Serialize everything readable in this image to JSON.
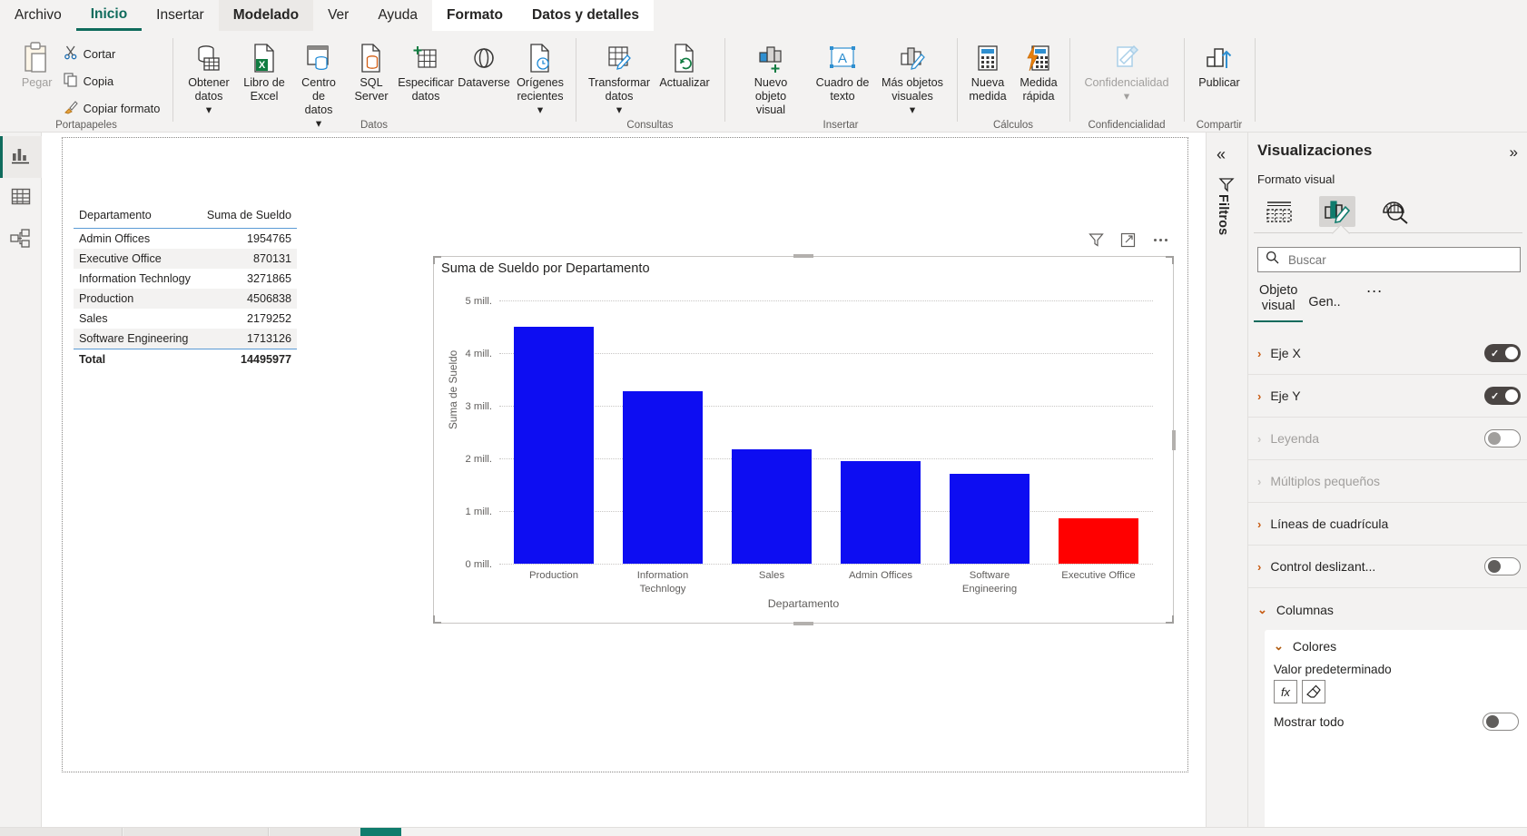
{
  "ribbon": {
    "tabs": [
      {
        "label": "Archivo",
        "style": "plain"
      },
      {
        "label": "Inicio",
        "style": "active"
      },
      {
        "label": "Insertar",
        "style": "plain"
      },
      {
        "label": "Modelado",
        "style": "shaded"
      },
      {
        "label": "Ver",
        "style": "plain"
      },
      {
        "label": "Ayuda",
        "style": "plain"
      },
      {
        "label": "Formato",
        "style": "white"
      },
      {
        "label": "Datos y detalles",
        "style": "white"
      }
    ],
    "groups": [
      {
        "name": "Portapapeles",
        "label": "Portapapeles",
        "paste_label": "Pegar",
        "items": [
          {
            "label": "Cortar",
            "icon": "scissors-icon"
          },
          {
            "label": "Copia",
            "icon": "copy-icon"
          },
          {
            "label": "Copiar formato",
            "icon": "format-painter-icon"
          }
        ]
      },
      {
        "name": "Datos",
        "label": "Datos",
        "items": [
          {
            "label": "Obtener\ndatos",
            "icon": "get-data-icon",
            "dropdown": true
          },
          {
            "label": "Libro de\nExcel",
            "icon": "excel-icon",
            "dropdown": false
          },
          {
            "label": "Centro de\ndatos",
            "icon": "data-hub-icon",
            "dropdown": true
          },
          {
            "label": "SQL\nServer",
            "icon": "sql-server-icon",
            "dropdown": false
          },
          {
            "label": "Especificar\ndatos",
            "icon": "enter-data-icon",
            "dropdown": false
          },
          {
            "label": "Dataverse",
            "icon": "dataverse-icon",
            "dropdown": false
          },
          {
            "label": "Orígenes\nrecientes",
            "icon": "recent-sources-icon",
            "dropdown": true
          }
        ]
      },
      {
        "name": "Consultas",
        "label": "Consultas",
        "items": [
          {
            "label": "Transformar\ndatos",
            "icon": "transform-data-icon",
            "dropdown": true
          },
          {
            "label": "Actualizar",
            "icon": "refresh-icon",
            "dropdown": false
          }
        ]
      },
      {
        "name": "Insertar",
        "label": "Insertar",
        "items": [
          {
            "label": "Nuevo objeto\nvisual",
            "icon": "new-visual-icon",
            "dropdown": false
          },
          {
            "label": "Cuadro de\ntexto",
            "icon": "text-box-icon",
            "dropdown": false
          },
          {
            "label": "Más objetos\nvisuales",
            "icon": "more-visuals-icon",
            "dropdown": true
          }
        ]
      },
      {
        "name": "Calculos",
        "label": "Cálculos",
        "items": [
          {
            "label": "Nueva\nmedida",
            "icon": "new-measure-icon",
            "dropdown": false
          },
          {
            "label": "Medida\nrápida",
            "icon": "quick-measure-icon",
            "dropdown": false
          }
        ]
      },
      {
        "name": "Confidencialidad",
        "label": "Confidencialidad",
        "items": [
          {
            "label": "Confidencialidad",
            "icon": "sensitivity-icon",
            "dropdown": true,
            "disabled": true
          }
        ]
      },
      {
        "name": "Compartir",
        "label": "Compartir",
        "items": [
          {
            "label": "Publicar",
            "icon": "publish-icon",
            "dropdown": false
          }
        ]
      }
    ]
  },
  "navrail": {
    "items": [
      {
        "name": "report-view",
        "icon": "report-chart-icon",
        "active": true
      },
      {
        "name": "table-view",
        "icon": "table-grid-icon",
        "active": false
      },
      {
        "name": "model-view",
        "icon": "model-relationship-icon",
        "active": false
      }
    ]
  },
  "table_visual": {
    "columns": [
      "Departamento",
      "Suma de Sueldo"
    ],
    "rows": [
      {
        "departamento": "Admin Offices",
        "sueldo": "1954765"
      },
      {
        "departamento": "Executive Office",
        "sueldo": "870131"
      },
      {
        "departamento": "Information Technlogy",
        "sueldo": "3271865"
      },
      {
        "departamento": "Production",
        "sueldo": "4506838"
      },
      {
        "departamento": "Sales",
        "sueldo": "2179252"
      },
      {
        "departamento": "Software Engineering",
        "sueldo": "1713126"
      }
    ],
    "total_label": "Total",
    "total_value": "14495977"
  },
  "chart_data": {
    "type": "bar",
    "title": "Suma de Sueldo por Departamento",
    "xlabel": "Departamento",
    "ylabel": "Suma de Sueldo",
    "categories": [
      "Production",
      "Information\nTechnlogy",
      "Sales",
      "Admin Offices",
      "Software\nEngineering",
      "Executive Office"
    ],
    "values": [
      4506838,
      3271865,
      2179252,
      1954765,
      1713126,
      870131
    ],
    "colors": [
      "#0D0DF2",
      "#0D0DF2",
      "#0D0DF2",
      "#0D0DF2",
      "#0D0DF2",
      "#FF0000"
    ],
    "ylim": [
      0,
      5000000
    ],
    "ytick_labels": [
      "0 mill.",
      "1 mill.",
      "2 mill.",
      "3 mill.",
      "4 mill.",
      "5 mill."
    ],
    "ytick_values": [
      0,
      1000000,
      2000000,
      3000000,
      4000000,
      5000000
    ],
    "grid": true,
    "legend": false,
    "header_icons": [
      "filter-icon",
      "focus-mode-icon",
      "more-options-icon"
    ]
  },
  "filters_strip": {
    "collapse_icon": "chevron-double-left-icon",
    "filter_icon": "filter-funnel-icon",
    "label": "Filtros"
  },
  "visualizations_pane": {
    "title": "Visualizaciones",
    "expand_icon": "chevron-double-right-icon",
    "subtitle": "Formato visual",
    "icons": [
      {
        "name": "fields-build-icon",
        "selected": false
      },
      {
        "name": "format-paint-visual-icon",
        "selected": true
      },
      {
        "name": "analytics-magnifier-icon",
        "selected": false
      }
    ],
    "search": {
      "placeholder": "Buscar",
      "value": "",
      "icon": "search-icon"
    },
    "tabs": [
      {
        "label": "Objeto\nvisual",
        "active": true
      },
      {
        "label": "Gen..",
        "active": false
      }
    ],
    "tabs_more": "···",
    "properties": [
      {
        "label": "Eje X",
        "toggle": "on",
        "disabled": false
      },
      {
        "label": "Eje Y",
        "toggle": "on",
        "disabled": false
      },
      {
        "label": "Leyenda",
        "toggle": "off",
        "disabled": true
      },
      {
        "label": "Múltiplos pequeños",
        "toggle": "none",
        "disabled": true
      },
      {
        "label": "Líneas de cuadrícula",
        "toggle": "none",
        "disabled": false
      },
      {
        "label": "Control deslizant...",
        "toggle": "off",
        "disabled": false
      }
    ],
    "columnas": {
      "label": "Columnas",
      "colores_label": "Colores",
      "valor_predeterminado_label": "Valor predeterminado",
      "fx_label": "fx",
      "eraser_icon": "eraser-icon",
      "mostrar_todo_label": "Mostrar todo",
      "mostrar_todo_toggle": "off"
    }
  },
  "colors": {
    "accent_green": "#0f6b5c",
    "bar_blue": "#0D0DF2",
    "bar_red": "#FF0000",
    "chrome": "#f3f2f1",
    "orange_chevron": "#b05a0e"
  }
}
